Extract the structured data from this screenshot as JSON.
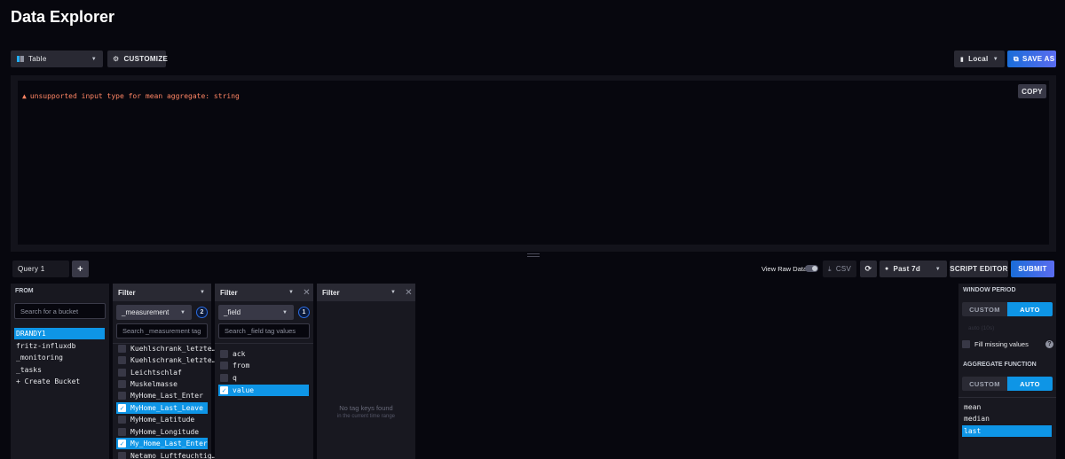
{
  "app": {
    "title": "Data Explorer"
  },
  "toolbar": {
    "view_type": "Table",
    "customize": "CUSTOMIZE",
    "timezone": "Local",
    "save_as": "SAVE AS"
  },
  "output": {
    "error": "unsupported input type for mean aggregate: string",
    "copy": "COPY"
  },
  "query_bar": {
    "tab": "Query 1",
    "add": "+",
    "view_raw": "View Raw Data",
    "csv": "CSV",
    "time_range": "Past 7d",
    "script_editor": "SCRIPT EDITOR",
    "submit": "SUBMIT"
  },
  "from": {
    "header": "FROM",
    "search_placeholder": "Search for a bucket",
    "buckets": [
      "DRANDY1",
      "fritz-influxdb",
      "_monitoring",
      "_tasks",
      "+ Create Bucket"
    ]
  },
  "filter1": {
    "header": "Filter",
    "key": "_measurement",
    "count": "2",
    "search_placeholder": "Search _measurement tag",
    "items": [
      {
        "label": "Kuehlschrank_letzte…",
        "checked": false
      },
      {
        "label": "Kuehlschrank_letzte…",
        "checked": false
      },
      {
        "label": "Leichtschlaf",
        "checked": false
      },
      {
        "label": "Muskelmasse",
        "checked": false
      },
      {
        "label": "MyHome_Last_Enter",
        "checked": false
      },
      {
        "label": "MyHome_Last_Leave",
        "checked": true
      },
      {
        "label": "MyHome_Latitude",
        "checked": false
      },
      {
        "label": "MyHome_Longitude",
        "checked": false
      },
      {
        "label": "My_Home_Last_Enter",
        "checked": true
      },
      {
        "label": "Netamo_Luftfeuchtig…",
        "checked": false
      }
    ]
  },
  "filter2": {
    "header": "Filter",
    "key": "_field",
    "count": "1",
    "search_placeholder": "Search _field tag values",
    "items": [
      {
        "label": "ack",
        "checked": false
      },
      {
        "label": "from",
        "checked": false
      },
      {
        "label": "q",
        "checked": false
      },
      {
        "label": "value",
        "checked": true
      }
    ]
  },
  "filter3": {
    "header": "Filter",
    "empty_title": "No tag keys found",
    "empty_sub": "in the current time range"
  },
  "window": {
    "header": "WINDOW PERIOD",
    "custom": "CUSTOM",
    "auto": "AUTO",
    "auto_hint": "auto (10s)",
    "fill_missing": "Fill missing values",
    "help": "?",
    "agg_header": "AGGREGATE FUNCTION",
    "agg_custom": "CUSTOM",
    "agg_auto": "AUTO",
    "functions": [
      "mean",
      "median",
      "last"
    ],
    "selected_function": "last"
  }
}
